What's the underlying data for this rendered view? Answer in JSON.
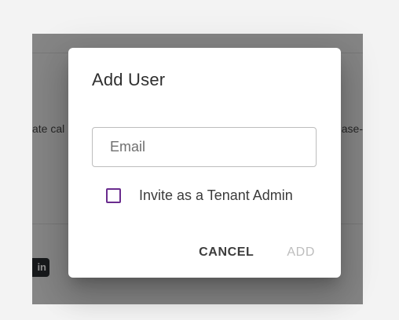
{
  "background": {
    "left_text": "ate cal",
    "right_text": "ase-",
    "chip_text": "in"
  },
  "dialog": {
    "title": "Add User",
    "email": {
      "value": "",
      "placeholder": "Email"
    },
    "invite_admin": {
      "label": "Invite as a Tenant Admin",
      "checked": false
    },
    "cancel_label": "CANCEL",
    "add_label": "ADD",
    "add_enabled": false
  },
  "colors": {
    "checkbox_border": "#6a2c8e",
    "disabled_text": "#bdbdbd"
  }
}
